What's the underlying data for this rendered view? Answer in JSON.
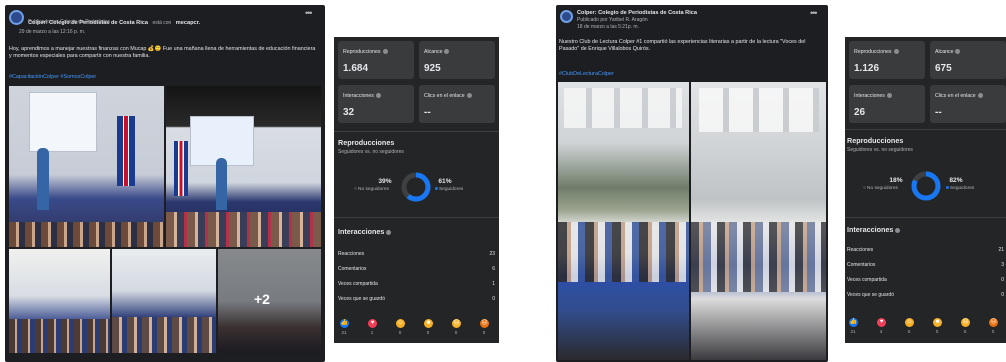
{
  "post1": {
    "page_name": "Colper: Colegio de Periodistas de Costa Rica",
    "status_suffix": "está con",
    "with": "mecapcr.",
    "published_by": "Publicado por Colegio de Periodistas",
    "date": "29 de marzo a las 12:16 p. m.",
    "text": "Hoy, aprendimos a manejar nuestras finanzas con Mucap 💰🙂 Fue una mañana llena de herramientas de educación financiera y momentos especiales para compartir con nuestra familia.",
    "hashtags": "#CapacitaciónColper #SomosColper",
    "more_photos": "+2"
  },
  "insights1": {
    "cards": [
      {
        "label": "Reproducciones",
        "value": "1.684"
      },
      {
        "label": "Alcance",
        "value": "925"
      },
      {
        "label": "Interacciones",
        "value": "32"
      },
      {
        "label": "Clics en el enlace",
        "value": "--"
      }
    ],
    "section_plays": "Reproducciones",
    "plays_sub": "Seguidores vs. no seguidores",
    "nonfollow_pct": "39%",
    "nonfollow_label": "No seguidores",
    "follow_pct": "61%",
    "follow_label": "Seguidores",
    "follow_fraction": 0.61,
    "section_interactions": "Interacciones",
    "rows": [
      {
        "label": "Reacciones",
        "value": "23"
      },
      {
        "label": "Comentarios",
        "value": "6"
      },
      {
        "label": "Veces compartida",
        "value": "1"
      },
      {
        "label": "Veces que se guardó",
        "value": "0"
      }
    ],
    "reaction_counts": [
      "21",
      "1",
      "0",
      "0",
      "0",
      "0"
    ]
  },
  "post2": {
    "page_name": "Colper: Colegio de Periodistas de Costa Rica",
    "published_by": "Publicado por Yaribel R. Aragón",
    "date": "18 de marzo a las 5:21p. m.",
    "text": "Nuestro Club de Lectura Colper #1 compartió las experiencias literarias a partir de la lectura \"Voces del Pasado\" de Enrique Villalobos Quirós.",
    "hashtags": "#ClubDeLecturaColper"
  },
  "insights2": {
    "cards": [
      {
        "label": "Reproducciones",
        "value": "1.126"
      },
      {
        "label": "Alcance",
        "value": "675"
      },
      {
        "label": "Interacciones",
        "value": "26"
      },
      {
        "label": "Clics en el enlace",
        "value": "--"
      }
    ],
    "section_plays": "Reproducciones",
    "plays_sub": "Seguidores vs. no seguidores",
    "nonfollow_pct": "18%",
    "nonfollow_label": "No seguidores",
    "follow_pct": "82%",
    "follow_label": "Seguidores",
    "follow_fraction": 0.82,
    "section_interactions": "Interacciones",
    "rows": [
      {
        "label": "Reacciones",
        "value": "21"
      },
      {
        "label": "Comentarios",
        "value": "3"
      },
      {
        "label": "Veces compartida",
        "value": "0"
      },
      {
        "label": "Veces que se guardó",
        "value": "0"
      }
    ],
    "reaction_counts": [
      "21",
      "4",
      "0",
      "0",
      "0",
      "0"
    ]
  },
  "reactions": [
    "like-icon",
    "love-icon",
    "care-icon",
    "haha-icon",
    "wow-icon",
    "angry-icon"
  ],
  "colors": {
    "accent": "#1877f2",
    "donut_track": "#3e4042",
    "tag": "#4599ff"
  }
}
